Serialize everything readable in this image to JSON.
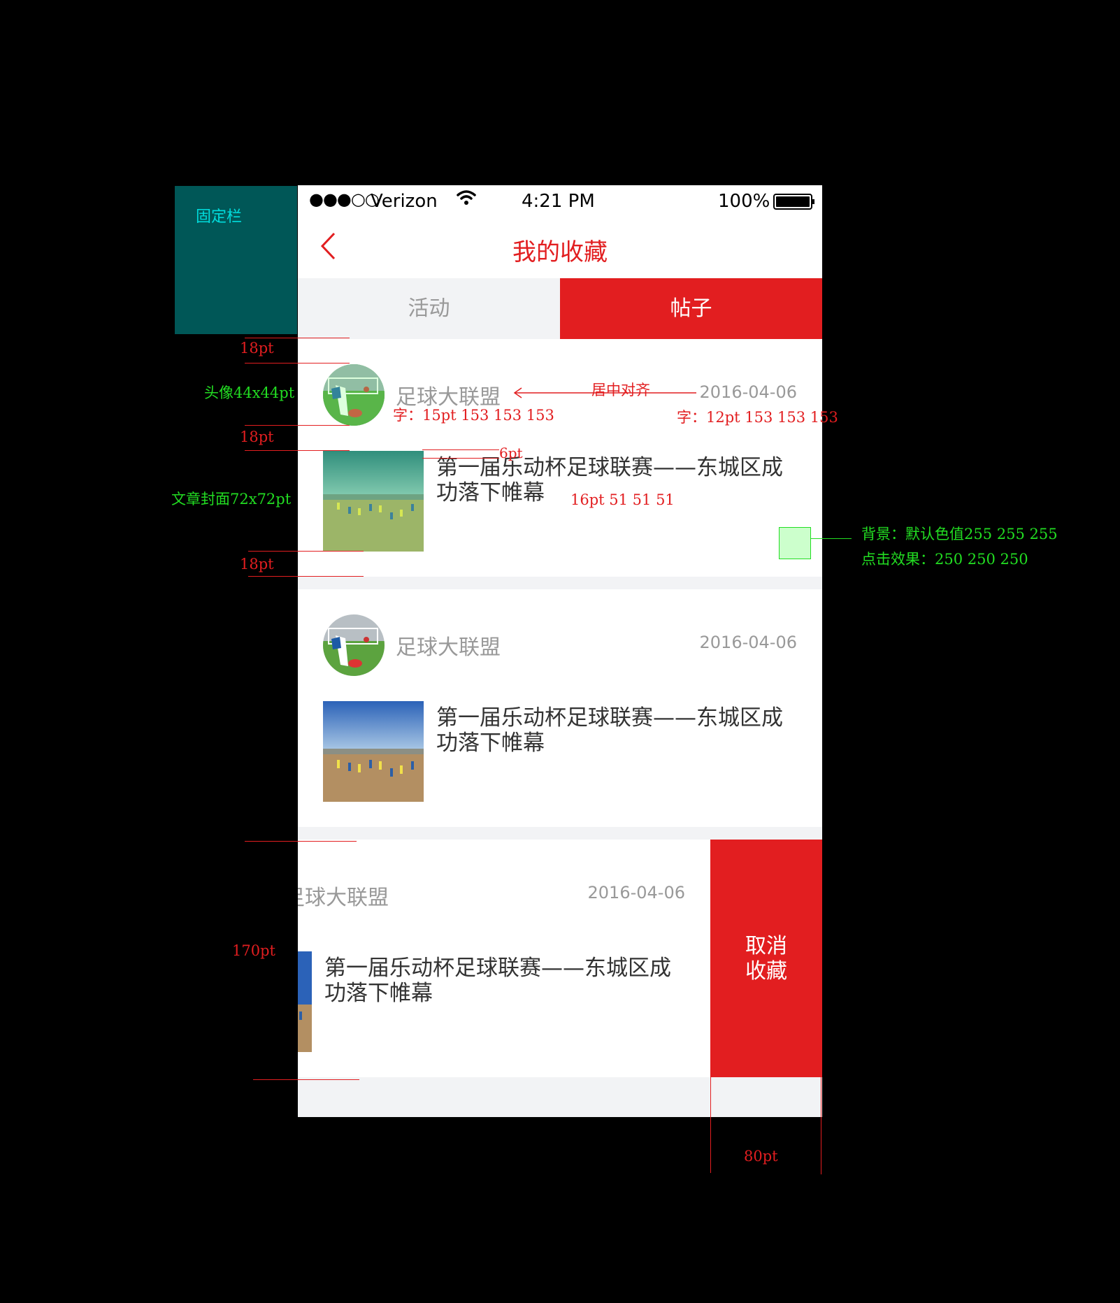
{
  "status_bar": {
    "carrier": "Verizon",
    "time": "4:21 PM",
    "battery": "100%"
  },
  "nav": {
    "title": "我的收藏"
  },
  "tabs": [
    {
      "label": "活动",
      "active": false
    },
    {
      "label": "帖子",
      "active": true
    }
  ],
  "posts": [
    {
      "author": "足球大联盟",
      "date": "2016-04-06",
      "title": "第一届乐动杯足球联赛——东城区成功落下帷幕"
    },
    {
      "author": "足球大联盟",
      "date": "2016-04-06",
      "title": "第一届乐动杯足球联赛——东城区成功落下帷幕"
    },
    {
      "author": "足球大联盟",
      "date": "2016-04-06",
      "title": "第一届乐动杯足球联赛——东城区成功落下帷幕",
      "swiped": true
    }
  ],
  "delete_action": {
    "label_line1": "取消",
    "label_line2": "收藏"
  },
  "annotations": {
    "fixed_bar": "固定栏",
    "spacing_18pt": "18pt",
    "avatar_size": "头像44x44pt",
    "cover_size": "文章封面72x72pt",
    "gap_6pt": "6pt",
    "center_align": "居中对齐",
    "author_font": "字：15pt 153 153 153",
    "date_font": "字：12pt 153 153 153",
    "title_font": "16pt 51 51 51",
    "bg_default": "背景：默认色值255 255 255",
    "bg_pressed": "点击效果：250 250 250",
    "row_height": "170pt",
    "button_width": "80pt"
  },
  "colors": {
    "brand_red": "#e21e20",
    "fixed_bar_bg": "#005757",
    "fixed_bar_text": "#00dddd",
    "annotation_green": "#22dd22"
  }
}
